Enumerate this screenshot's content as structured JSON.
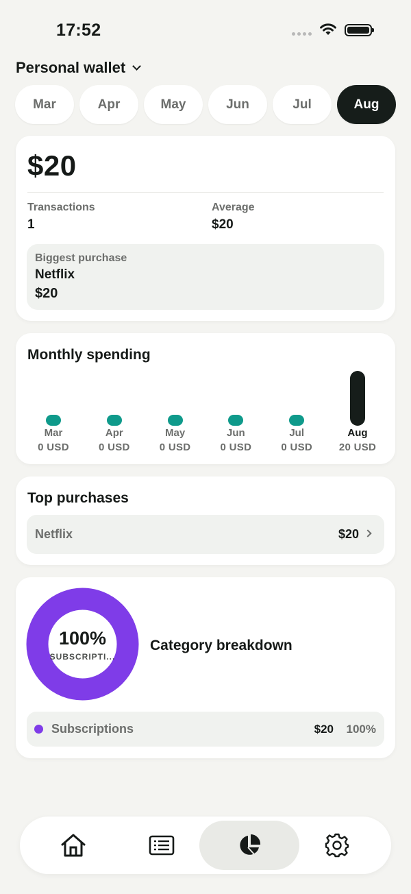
{
  "status_bar": {
    "time": "17:52"
  },
  "wallet": {
    "name": "Personal wallet"
  },
  "months": [
    {
      "label": "Mar",
      "active": false
    },
    {
      "label": "Apr",
      "active": false
    },
    {
      "label": "May",
      "active": false
    },
    {
      "label": "Jun",
      "active": false
    },
    {
      "label": "Jul",
      "active": false
    },
    {
      "label": "Aug",
      "active": true
    }
  ],
  "summary": {
    "total": "$20",
    "transactions_label": "Transactions",
    "transactions_value": "1",
    "average_label": "Average",
    "average_value": "$20",
    "biggest_label": "Biggest purchase",
    "biggest_name": "Netflix",
    "biggest_value": "$20"
  },
  "monthly_spending": {
    "title": "Monthly spending",
    "colors": {
      "zero": "#0f9a8b",
      "active": "#161d1a"
    }
  },
  "chart_data": {
    "type": "bar",
    "title": "Monthly spending",
    "categories": [
      "Mar",
      "Apr",
      "May",
      "Jun",
      "Jul",
      "Aug"
    ],
    "values": [
      0,
      0,
      0,
      0,
      0,
      20
    ],
    "value_labels": [
      "0 USD",
      "0 USD",
      "0 USD",
      "0 USD",
      "0 USD",
      "20 USD"
    ],
    "unit": "USD",
    "highlighted": "Aug"
  },
  "top_purchases": {
    "title": "Top purchases",
    "items": [
      {
        "name": "Netflix",
        "amount": "$20"
      }
    ]
  },
  "category_breakdown": {
    "title": "Category breakdown",
    "donut_percent": "100%",
    "donut_label": "SUBSCRIPTI...",
    "ring_color": "#7f3ce8",
    "items": [
      {
        "name": "Subscriptions",
        "amount": "$20",
        "percent": "100%",
        "share": 1.0,
        "color": "#7f3ce8"
      }
    ]
  },
  "nav": {
    "items": [
      {
        "name": "home",
        "icon": "home-icon",
        "active": false
      },
      {
        "name": "transactions",
        "icon": "list-icon",
        "active": false
      },
      {
        "name": "stats",
        "icon": "pie-chart-icon",
        "active": true
      },
      {
        "name": "settings",
        "icon": "gear-icon",
        "active": false
      }
    ]
  }
}
